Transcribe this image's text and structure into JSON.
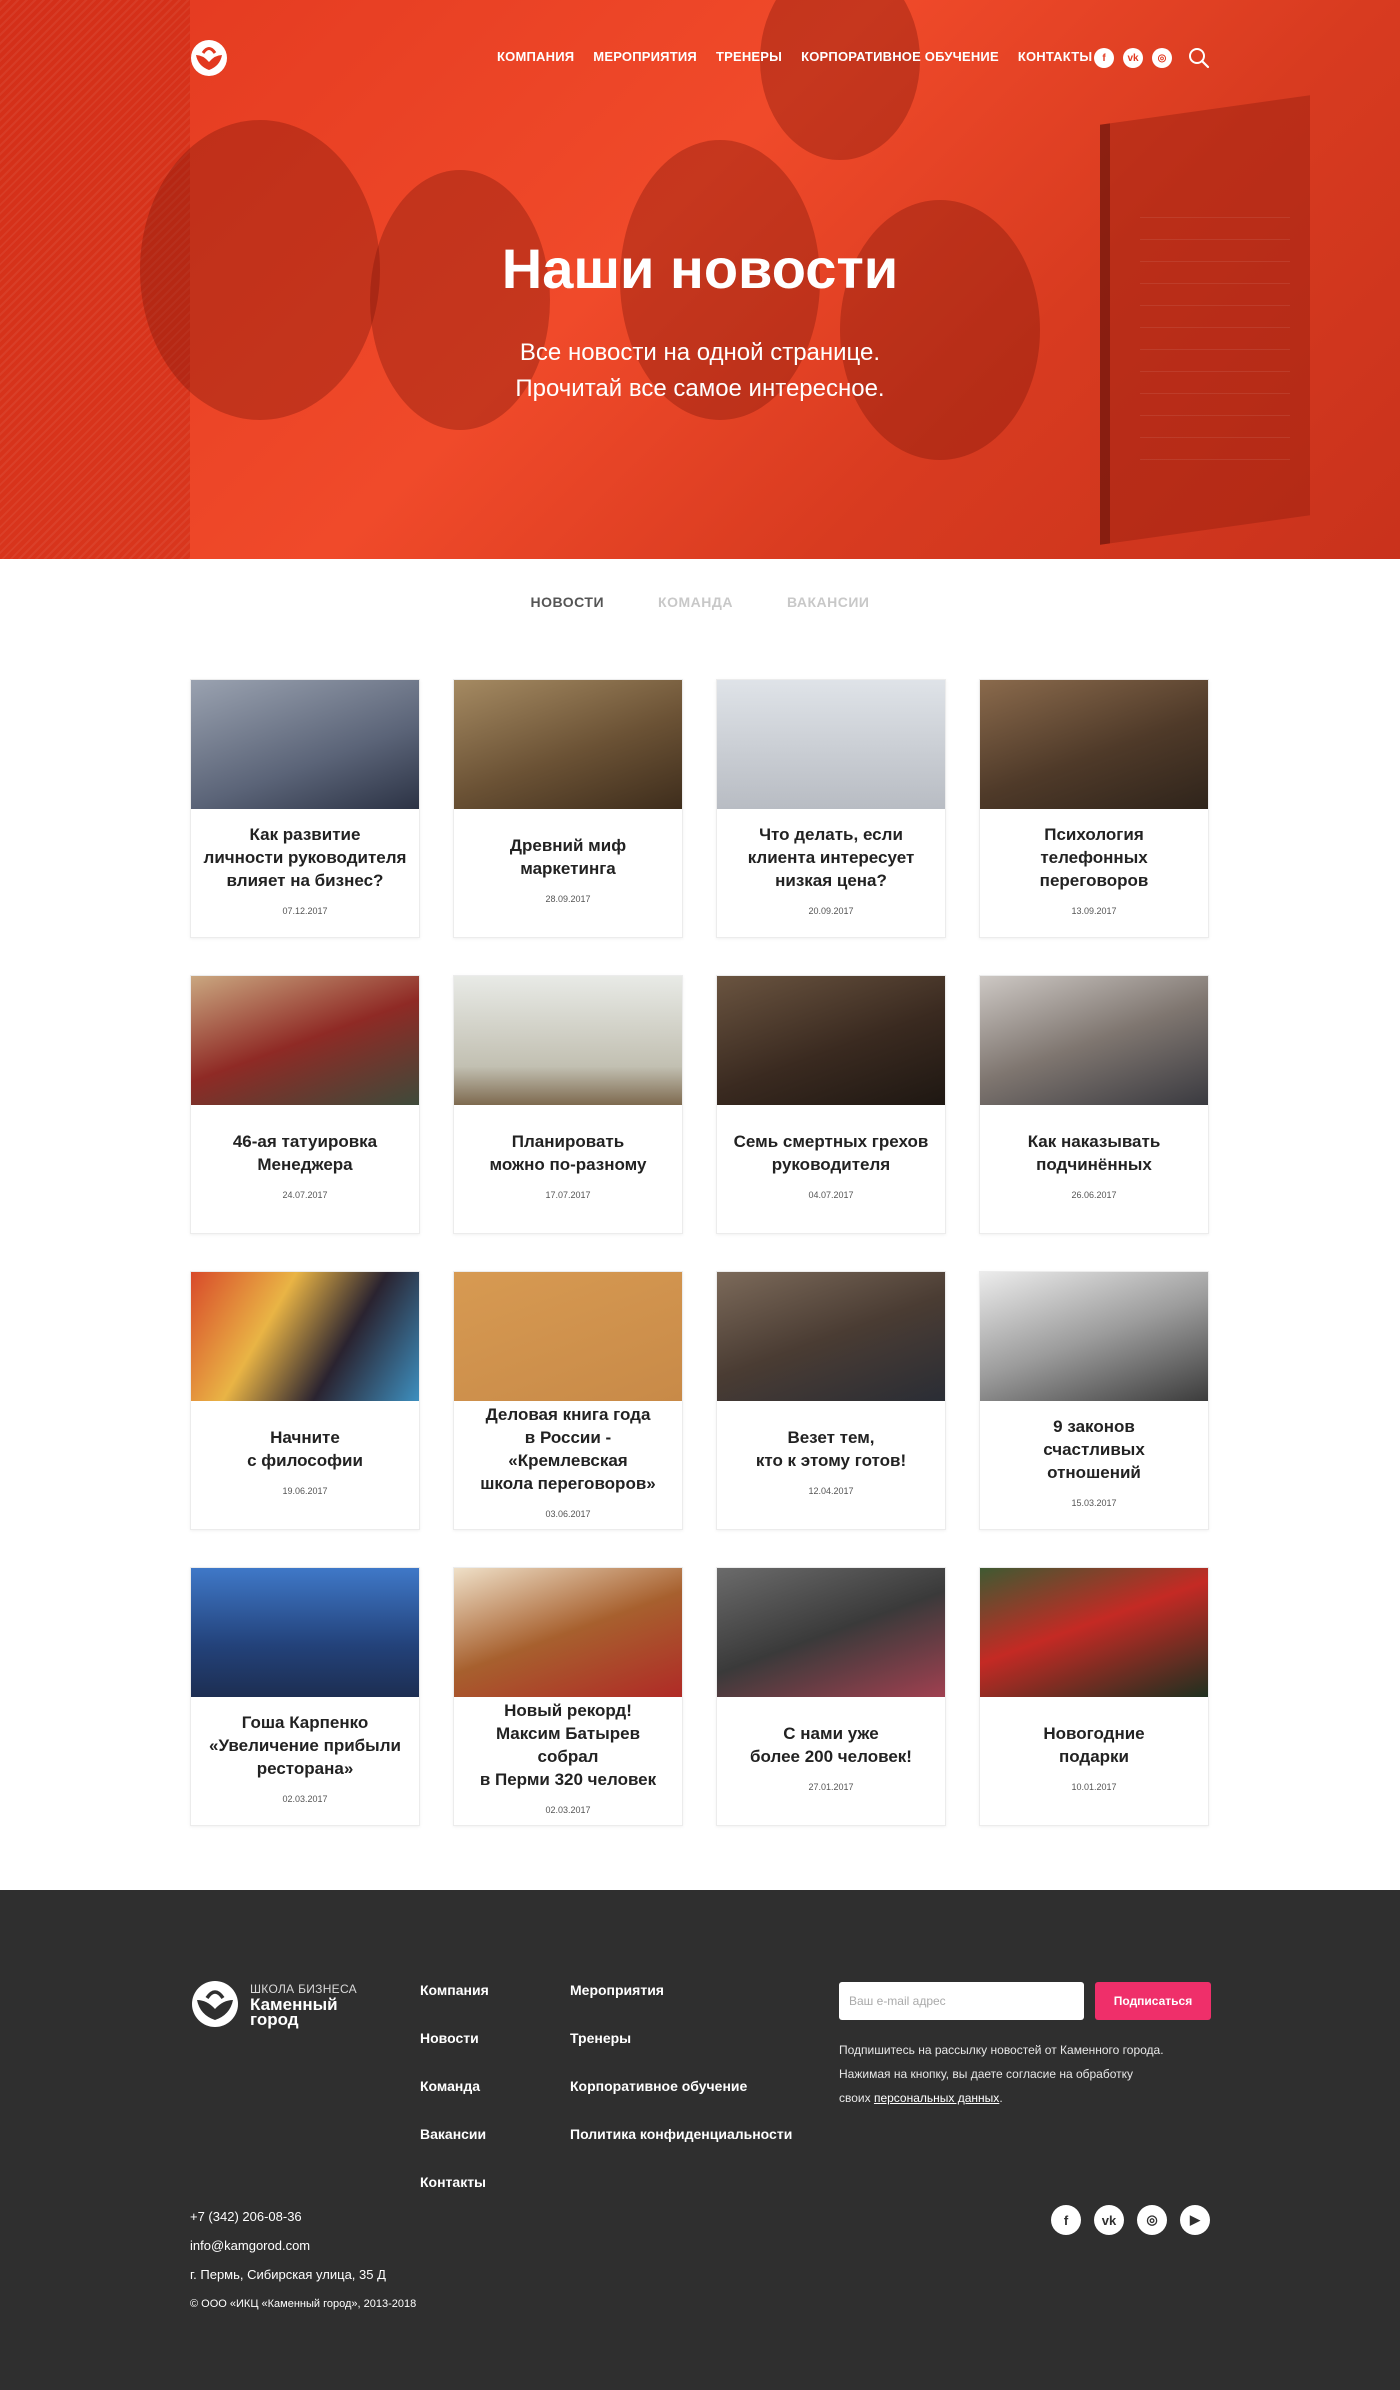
{
  "header": {
    "menu": [
      "Компания",
      "Мероприятия",
      "Тренеры",
      "Корпоративное обучение",
      "Контакты"
    ],
    "socials": [
      "facebook-icon",
      "vk-icon",
      "instagram-icon"
    ],
    "brand_color": "#e2381f"
  },
  "hero": {
    "title": "Наши новости",
    "subtitle_line1": "Все новости на одной странице.",
    "subtitle_line2": "Прочитай все самое интересное."
  },
  "tabs": [
    {
      "label": "Новости",
      "active": true
    },
    {
      "label": "Команда",
      "active": false
    },
    {
      "label": "Вакансии",
      "active": false
    }
  ],
  "news": [
    {
      "title": "Как развитие\nличности руководителя\nвлияет на бизнес?",
      "date": "07.12.2017"
    },
    {
      "title": "Древний миф\nмаркетинга",
      "date": "28.09.2017"
    },
    {
      "title": "Что делать, если\nклиента интересует\nнизкая цена?",
      "date": "20.09.2017"
    },
    {
      "title": "Психология\nтелефонных\nпереговоров",
      "date": "13.09.2017"
    },
    {
      "title": "46-ая татуировка\nМенеджера",
      "date": "24.07.2017"
    },
    {
      "title": "Планировать\nможно по-разному",
      "date": "17.07.2017"
    },
    {
      "title": "Семь смертных грехов\nруководителя",
      "date": "04.07.2017"
    },
    {
      "title": "Как наказывать\nподчинённых",
      "date": "26.06.2017"
    },
    {
      "title": "Начните\nс философии",
      "date": "19.06.2017"
    },
    {
      "title": "Деловая книга года\nв России - «Кремлевская\nшкола переговоров»",
      "date": "03.06.2017"
    },
    {
      "title": "Везет тем,\nкто к этому готов!",
      "date": "12.04.2017"
    },
    {
      "title": "9 законов\nсчастливых\nотношений",
      "date": "15.03.2017"
    },
    {
      "title": "Гоша Карпенко\n«Увеличение прибыли\nресторана»",
      "date": "02.03.2017"
    },
    {
      "title": "Новый рекорд!\nМаксим Батырев собрал\nв Перми 320 человек",
      "date": "02.03.2017"
    },
    {
      "title": "С нами уже\nболее 200 человек!",
      "date": "27.01.2017"
    },
    {
      "title": "Новогодние\nподарки",
      "date": "10.01.2017"
    }
  ],
  "footer": {
    "logo_small": "Школа бизнеса",
    "logo_big_line1": "Каменный",
    "logo_big_line2": "город",
    "col1": [
      "Компания",
      "Новости",
      "Команда",
      "Вакансии",
      "Контакты"
    ],
    "col2": [
      "Мероприятия",
      "Тренеры",
      "Корпоративное обучение",
      "Политика конфиденциальности"
    ],
    "subscribe_placeholder": "Ваш e-mail адрес",
    "subscribe_button": "Подписаться",
    "note_line1": "Подпишитесь на рассылку новостей от Каменного города.",
    "note_line2": "Нажимая на кнопку, вы даете согласие на обработку",
    "note_line3_prefix": "своих ",
    "note_link": "персональных данных",
    "note_line3_suffix": ".",
    "phone": "+7 (342) 206-08-36",
    "email": "info@kamgorod.com",
    "address": "г. Пермь, Сибирская улица, 35 Д",
    "copyright": "© ООО «ИКЦ «Каменный город», 2013-2018",
    "socials": [
      "facebook-icon",
      "vk-icon",
      "instagram-icon",
      "youtube-icon"
    ],
    "accent_color": "#ef2f6a",
    "bg_color": "#2f2f2f"
  }
}
